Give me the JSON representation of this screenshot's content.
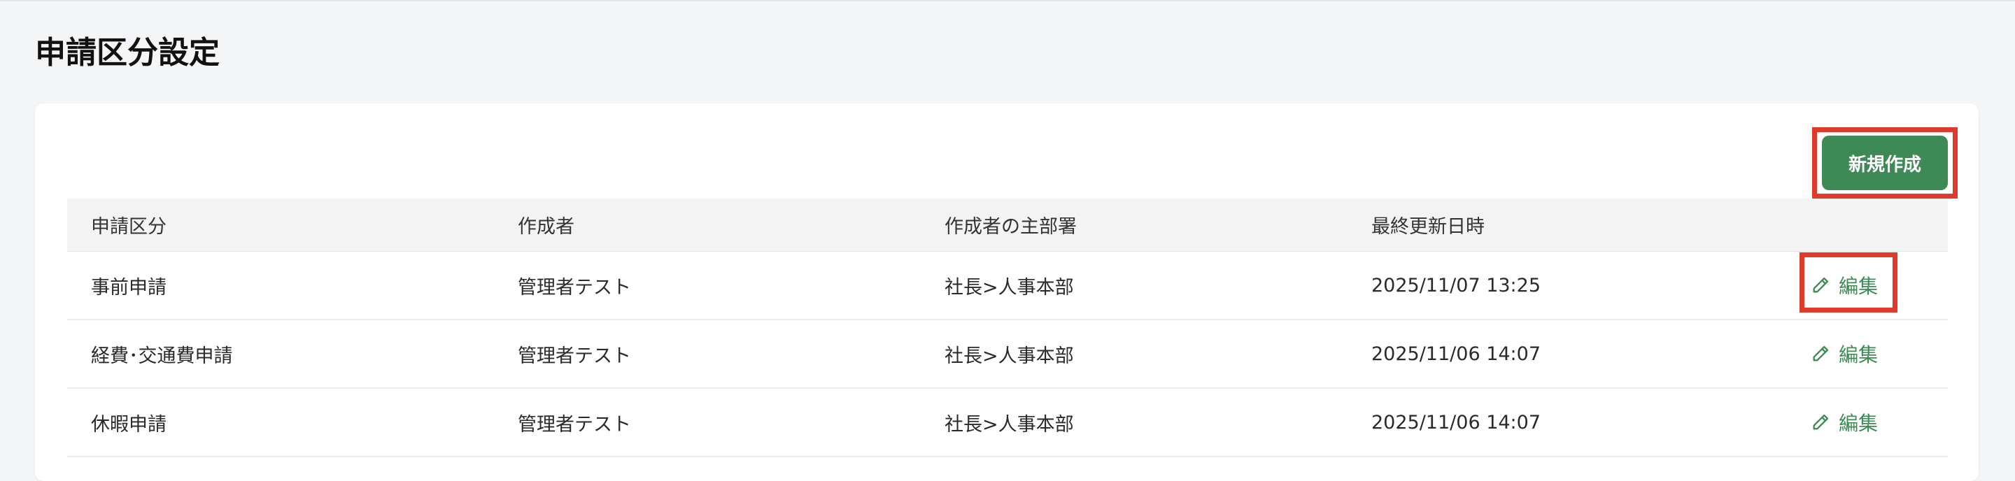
{
  "page": {
    "title": "申請区分設定"
  },
  "toolbar": {
    "new_label": "新規作成"
  },
  "table": {
    "columns": [
      "申請区分",
      "作成者",
      "作成者の主部署",
      "最終更新日時",
      ""
    ],
    "rows": [
      {
        "category": "事前申請",
        "creator": "管理者テスト",
        "department": "社長>人事本部",
        "updated": "2025/11/07 13:25",
        "action": "編集"
      },
      {
        "category": "経費･交通費申請",
        "creator": "管理者テスト",
        "department": "社長>人事本部",
        "updated": "2025/11/06 14:07",
        "action": "編集"
      },
      {
        "category": "休暇申請",
        "creator": "管理者テスト",
        "department": "社長>人事本部",
        "updated": "2025/11/06 14:07",
        "action": "編集"
      }
    ]
  },
  "icons": {
    "edit": "pencil-icon"
  },
  "colors": {
    "primary": "#3d8a56",
    "highlight": "#e03a2b",
    "background": "#f4f5f7"
  }
}
